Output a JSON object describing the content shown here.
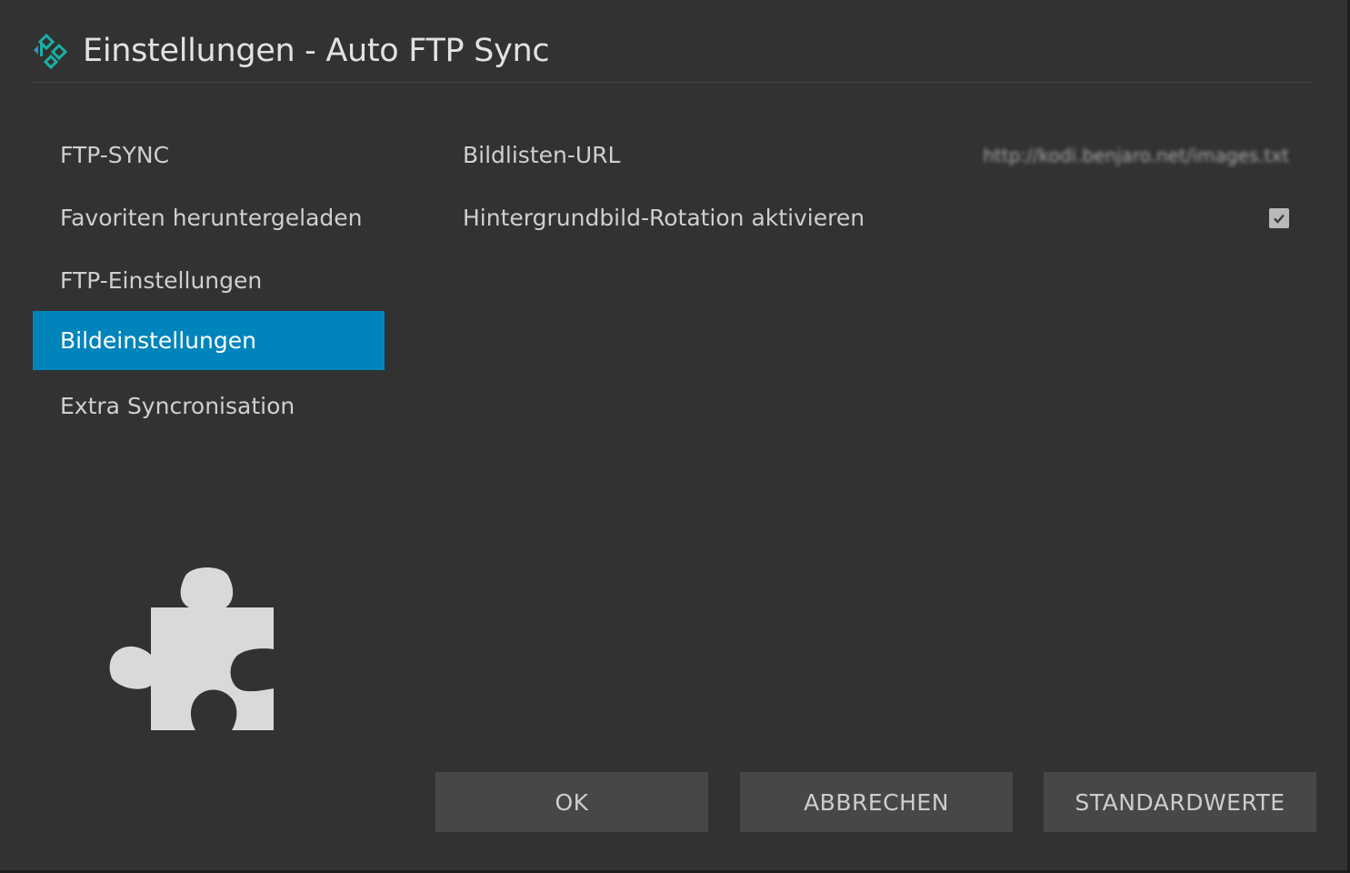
{
  "dialog": {
    "title": "Einstellungen - Auto FTP Sync"
  },
  "categories": [
    {
      "label": "FTP-SYNC",
      "active": false
    },
    {
      "label": "Favoriten heruntergeladen",
      "active": false
    },
    {
      "label": "FTP-Einstellungen",
      "active": false
    },
    {
      "label": "Bildeinstellungen",
      "active": true
    },
    {
      "label": "Extra Syncronisation",
      "active": false
    }
  ],
  "settings": [
    {
      "label": "Bildlisten-URL",
      "value": "http://kodi.benjaro.net/images.txt",
      "type": "text"
    },
    {
      "label": "Hintergrundbild-Rotation aktivieren",
      "checked": true,
      "type": "checkbox"
    }
  ],
  "buttons": {
    "ok": "OK",
    "cancel": "ABBRECHEN",
    "defaults": "STANDARDWERTE"
  },
  "colors": {
    "accent": "#0084bc",
    "background": "#323232",
    "button": "#474747",
    "logo_primary": "#17b2a5",
    "logo_secondary": "#3a8fc4"
  },
  "icons": {
    "app_logo": "kodi-logo-icon",
    "addon_icon": "puzzle-piece-icon",
    "check": "checkmark-icon"
  }
}
